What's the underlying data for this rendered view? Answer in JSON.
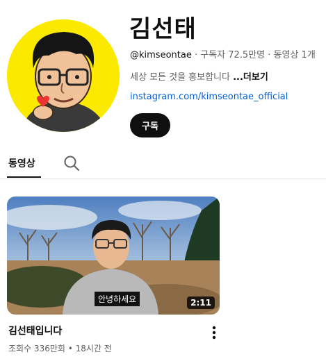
{
  "channel": {
    "name": "김선태",
    "handle": "@kimseontae",
    "subscribers": "구독자 72.5만명",
    "video_count": "동영상 1개",
    "separator": " · ",
    "description": "세상 모든 것을 홍보합니다 ",
    "more_label": "...더보기",
    "link": "instagram.com/kimseontae_official",
    "subscribe_label": "구독",
    "avatar_bg": "#fbe900"
  },
  "tabs": {
    "videos": "동영상",
    "search_icon": "search-icon"
  },
  "video": {
    "title": "김선태입니다",
    "views": "조회수 336만회",
    "meta_sep": " • ",
    "age": "18시간 전",
    "duration": "2:11",
    "caption": "안녕하세요",
    "menu_icon": "more-vert-icon"
  }
}
